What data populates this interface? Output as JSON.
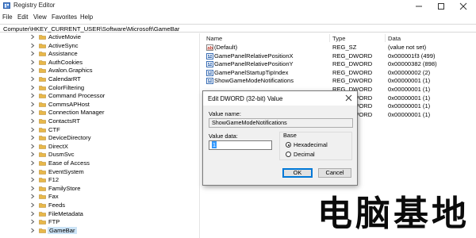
{
  "window": {
    "title": "Registry Editor"
  },
  "menu": [
    "File",
    "Edit",
    "View",
    "Favorites",
    "Help"
  ],
  "address": "Computer\\HKEY_CURRENT_USER\\Software\\Microsoft\\GameBar",
  "tree": [
    {
      "label": "ActiveMovie",
      "selected": false
    },
    {
      "label": "ActiveSync",
      "selected": false
    },
    {
      "label": "Assistance",
      "selected": false
    },
    {
      "label": "AuthCookies",
      "selected": false
    },
    {
      "label": "Avalon.Graphics",
      "selected": false
    },
    {
      "label": "CalendarRT",
      "selected": false
    },
    {
      "label": "ColorFiltering",
      "selected": false
    },
    {
      "label": "Command Processor",
      "selected": false
    },
    {
      "label": "CommsAPHost",
      "selected": false
    },
    {
      "label": "Connection Manager",
      "selected": false
    },
    {
      "label": "ContactsRT",
      "selected": false
    },
    {
      "label": "CTF",
      "selected": false
    },
    {
      "label": "DeviceDirectory",
      "selected": false
    },
    {
      "label": "DirectX",
      "selected": false
    },
    {
      "label": "DusmSvc",
      "selected": false
    },
    {
      "label": "Ease of Access",
      "selected": false
    },
    {
      "label": "EventSystem",
      "selected": false
    },
    {
      "label": "F12",
      "selected": false
    },
    {
      "label": "FamilyStore",
      "selected": false
    },
    {
      "label": "Fax",
      "selected": false
    },
    {
      "label": "Feeds",
      "selected": false
    },
    {
      "label": "FileMetadata",
      "selected": false
    },
    {
      "label": "FTP",
      "selected": false
    },
    {
      "label": "GameBar",
      "selected": true
    }
  ],
  "columns": {
    "name": "Name",
    "type": "Type",
    "data": "Data"
  },
  "values": [
    {
      "name": "(Default)",
      "type": "REG_SZ",
      "data": "(value not set)",
      "icon": "string-value-icon"
    },
    {
      "name": "GamePanelRelativePositionX",
      "type": "REG_DWORD",
      "data": "0x000001f3 (499)",
      "icon": "dword-value-icon"
    },
    {
      "name": "GamePanelRelativePositionY",
      "type": "REG_DWORD",
      "data": "0x00000382 (898)",
      "icon": "dword-value-icon"
    },
    {
      "name": "GamePanelStartupTipIndex",
      "type": "REG_DWORD",
      "data": "0x00000002 (2)",
      "icon": "dword-value-icon"
    },
    {
      "name": "ShowGameModeNotifications",
      "type": "REG_DWORD",
      "data": "0x00000001 (1)",
      "icon": "dword-value-icon"
    },
    {
      "name": "",
      "type": "REG_DWORD",
      "data": "0x00000001 (1)",
      "icon": ""
    },
    {
      "name": "",
      "type": "REG_DWORD",
      "data": "0x00000001 (1)",
      "icon": ""
    },
    {
      "name": "",
      "type": "REG_DWORD",
      "data": "0x00000001 (1)",
      "icon": ""
    },
    {
      "name": "",
      "type": "REG_DWORD",
      "data": "0x00000001 (1)",
      "icon": ""
    }
  ],
  "dialog": {
    "title": "Edit DWORD (32-bit) Value",
    "value_name_label": "Value name:",
    "value_name": "ShowGameModeNotifications",
    "value_data_label": "Value data:",
    "value_data": "1",
    "base_label": "Base",
    "hex_label": "Hexadecimal",
    "dec_label": "Decimal",
    "base_selected": "Hexadecimal",
    "ok_label": "OK",
    "cancel_label": "Cancel"
  },
  "watermark": "电脑基地",
  "colors": {
    "selection": "#cce4f7",
    "folder": "#e8b84a",
    "dword_icon": "#3c6fb5",
    "string_icon": "#c0392b",
    "focus": "#0078d7"
  }
}
